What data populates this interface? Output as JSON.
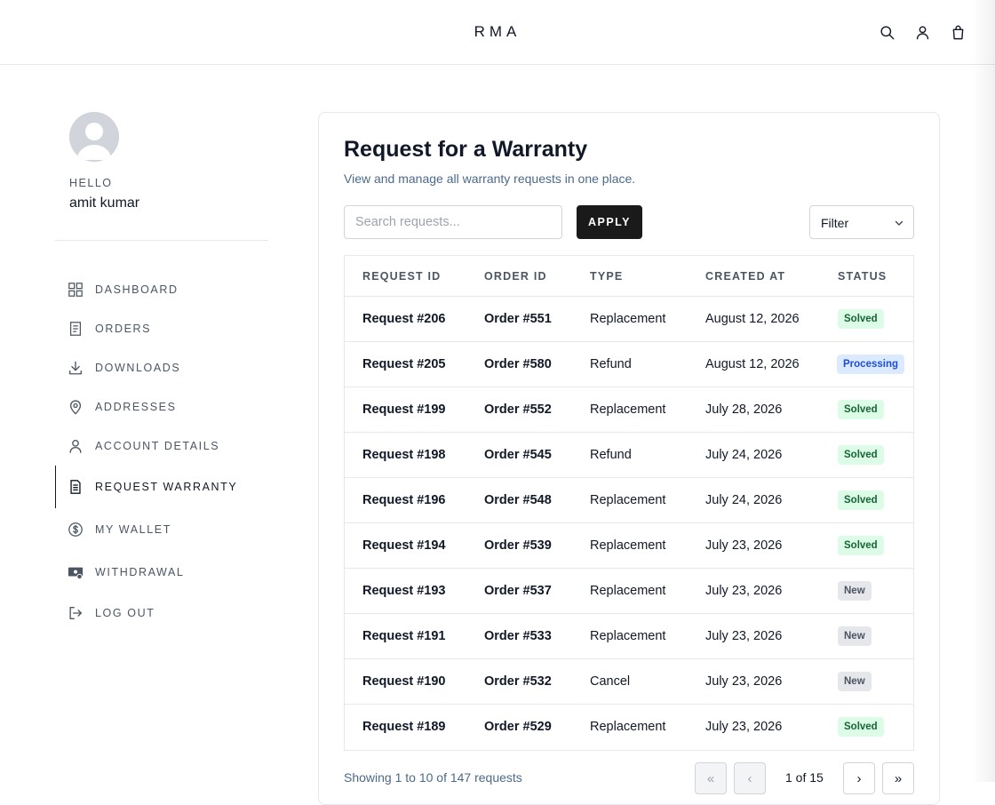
{
  "header": {
    "brand": "RMA",
    "icons": [
      "search-icon",
      "user-icon",
      "bag-icon"
    ]
  },
  "profile": {
    "greeting": "HELLO",
    "name": "amit kumar"
  },
  "sidebar": {
    "items": [
      {
        "label": "DASHBOARD",
        "icon": "dashboard-icon"
      },
      {
        "label": "ORDERS",
        "icon": "orders-icon"
      },
      {
        "label": "DOWNLOADS",
        "icon": "download-icon"
      },
      {
        "label": "ADDRESSES",
        "icon": "location-pin-icon"
      },
      {
        "label": "ACCOUNT DETAILS",
        "icon": "user-icon"
      },
      {
        "label": "REQUEST WARRANTY",
        "icon": "document-icon",
        "active": true
      },
      {
        "label": "MY WALLET",
        "icon": "dollar-circle-icon"
      },
      {
        "label": "WITHDRAWAL",
        "icon": "withdrawal-icon"
      },
      {
        "label": "LOG OUT",
        "icon": "logout-icon"
      }
    ]
  },
  "main": {
    "title": "Request for a Warranty",
    "subtitle": "View and manage all warranty requests in one place.",
    "search_placeholder": "Search requests...",
    "apply_label": "APPLY",
    "filter_value": "Filter"
  },
  "table": {
    "headers": [
      "REQUEST ID",
      "ORDER ID",
      "TYPE",
      "CREATED AT",
      "STATUS"
    ],
    "rows": [
      {
        "request": "Request #206",
        "order": "Order #551",
        "type": "Replacement",
        "created": "August 12, 2026",
        "status": "Solved"
      },
      {
        "request": "Request #205",
        "order": "Order #580",
        "type": "Refund",
        "created": "August 12, 2026",
        "status": "Processing"
      },
      {
        "request": "Request #199",
        "order": "Order #552",
        "type": "Replacement",
        "created": "July 28, 2026",
        "status": "Solved"
      },
      {
        "request": "Request #198",
        "order": "Order #545",
        "type": "Refund",
        "created": "July 24, 2026",
        "status": "Solved"
      },
      {
        "request": "Request #196",
        "order": "Order #548",
        "type": "Replacement",
        "created": "July 24, 2026",
        "status": "Solved"
      },
      {
        "request": "Request #194",
        "order": "Order #539",
        "type": "Replacement",
        "created": "July 23, 2026",
        "status": "Solved"
      },
      {
        "request": "Request #193",
        "order": "Order #537",
        "type": "Replacement",
        "created": "July 23, 2026",
        "status": "New"
      },
      {
        "request": "Request #191",
        "order": "Order #533",
        "type": "Replacement",
        "created": "July 23, 2026",
        "status": "New"
      },
      {
        "request": "Request #190",
        "order": "Order #532",
        "type": "Cancel",
        "created": "July 23, 2026",
        "status": "New"
      },
      {
        "request": "Request #189",
        "order": "Order #529",
        "type": "Replacement",
        "created": "July 23, 2026",
        "status": "Solved"
      }
    ]
  },
  "pagination": {
    "showing": "Showing 1 to 10 of 147 requests",
    "first": "«",
    "prev": "‹",
    "page_text": "1 of 15",
    "next": "›",
    "last": "»"
  },
  "colors": {
    "solved_bg": "#dcfce7",
    "solved_fg": "#166534",
    "processing_bg": "#dbeafe",
    "processing_fg": "#1d4ed8",
    "new_bg": "#e5e7eb",
    "new_fg": "#4b5563",
    "primary_button": "#1a1a1a"
  }
}
